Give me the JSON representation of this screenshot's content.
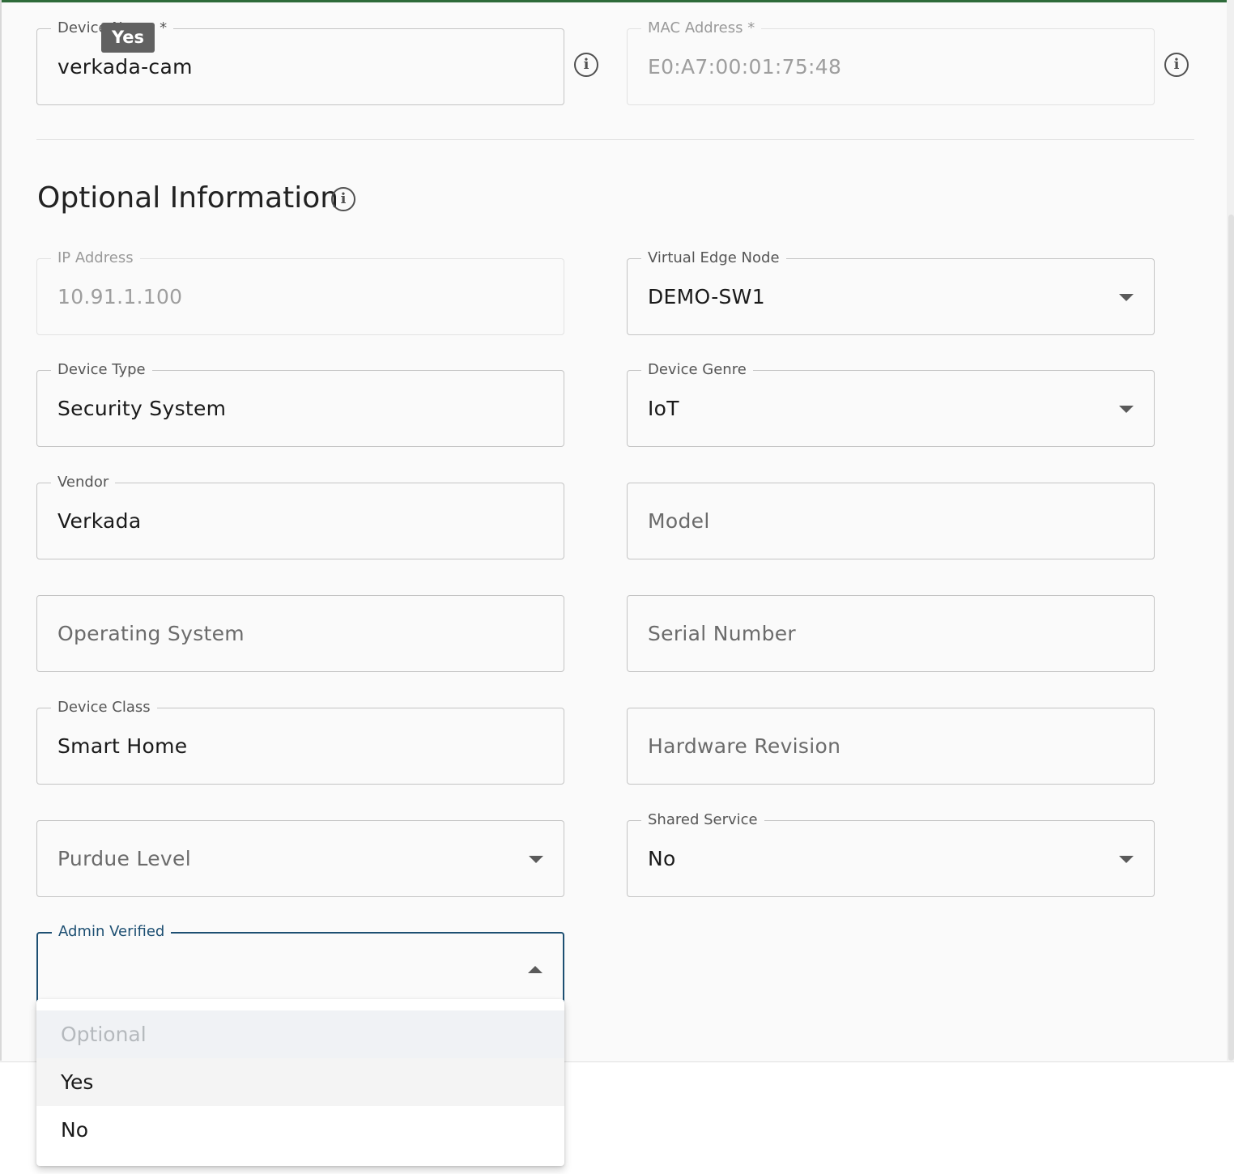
{
  "tooltip": {
    "text": "Yes"
  },
  "required": {
    "device_name": {
      "label": "Device Name *",
      "value": "verkada-cam"
    },
    "mac_address": {
      "label": "MAC Address *",
      "value": "E0:A7:00:01:75:48"
    }
  },
  "optional": {
    "title": "Optional Information",
    "ip_address": {
      "label": "IP Address",
      "value": "10.91.1.100"
    },
    "virtual_edge_node": {
      "label": "Virtual Edge Node",
      "value": "DEMO-SW1"
    },
    "device_type": {
      "label": "Device Type",
      "value": "Security System"
    },
    "device_genre": {
      "label": "Device Genre",
      "value": "IoT"
    },
    "vendor": {
      "label": "Vendor",
      "value": "Verkada"
    },
    "model": {
      "placeholder": "Model"
    },
    "operating_system": {
      "placeholder": "Operating System"
    },
    "serial_number": {
      "placeholder": "Serial Number"
    },
    "device_class": {
      "label": "Device Class",
      "value": "Smart Home"
    },
    "hardware_revision": {
      "placeholder": "Hardware Revision"
    },
    "purdue_level": {
      "placeholder": "Purdue Level"
    },
    "shared_service": {
      "label": "Shared Service",
      "value": "No"
    },
    "admin_verified": {
      "label": "Admin Verified",
      "value": ""
    }
  },
  "admin_verified_menu": {
    "options": [
      "Optional",
      "Yes",
      "No"
    ]
  },
  "colors": {
    "accent": "#1d4f72",
    "top_bar": "#2e6b3a"
  },
  "icons": {
    "info": "info-circle-icon",
    "dropdown": "caret-down-icon",
    "dropdown_open": "caret-up-icon"
  }
}
